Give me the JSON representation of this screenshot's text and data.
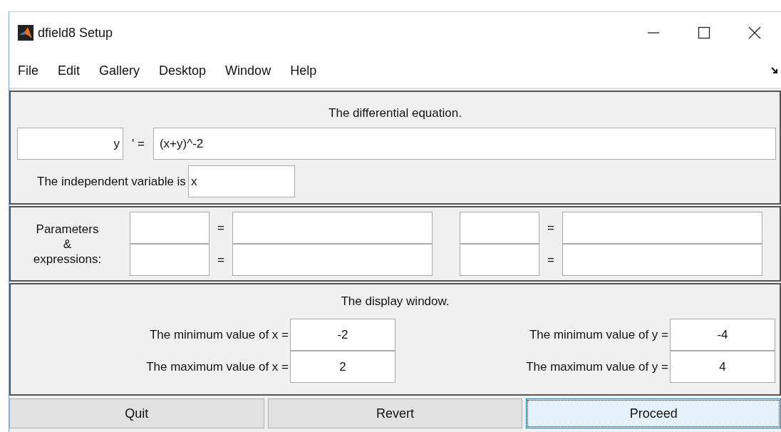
{
  "window": {
    "title": "dfield8 Setup"
  },
  "menu": [
    "File",
    "Edit",
    "Gallery",
    "Desktop",
    "Window",
    "Help"
  ],
  "equation": {
    "title": "The differential equation.",
    "dependent": "y",
    "prime_equals": "' =",
    "expression": "(x+y)^-2",
    "independent_label": "The independent variable is",
    "independent": "x"
  },
  "parameters": {
    "label_lines": [
      "Parameters",
      "&",
      "expressions:"
    ],
    "rows": [
      {
        "equals_left": "=",
        "equals_right": "="
      },
      {
        "equals_left": "=",
        "equals_right": "="
      }
    ]
  },
  "display": {
    "title": "The display window.",
    "rows": [
      {
        "x_label": "The minimum value of x =",
        "x_value": "-2",
        "y_label": "The minimum value of y =",
        "y_value": "-4"
      },
      {
        "x_label": "The maximum value of x =",
        "x_value": "2",
        "y_label": "The maximum value of y =",
        "y_value": "4"
      }
    ]
  },
  "buttons": [
    {
      "label": "Quit",
      "focused": false
    },
    {
      "label": "Revert",
      "focused": false
    },
    {
      "label": "Proceed",
      "focused": true
    }
  ]
}
